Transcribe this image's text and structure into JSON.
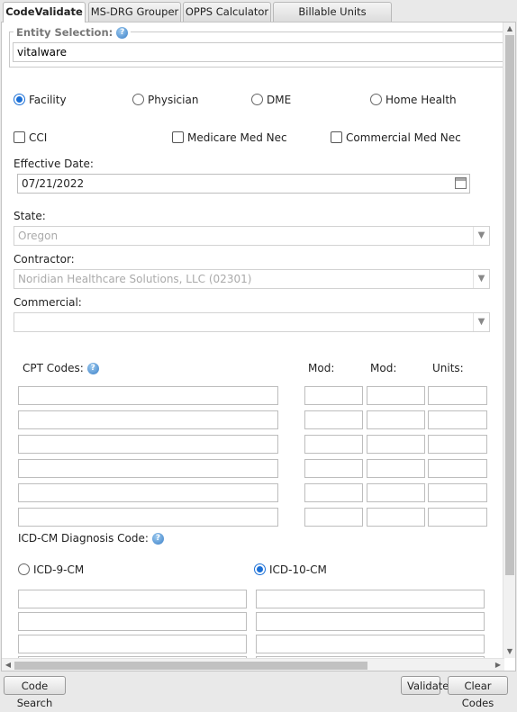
{
  "tabs": [
    {
      "label": "CodeValidate",
      "active": true
    },
    {
      "label": "MS-DRG Grouper",
      "active": false
    },
    {
      "label": "OPPS Calculator",
      "active": false
    },
    {
      "label": "Billable Units Calculator",
      "active": false
    }
  ],
  "entity": {
    "legend": "Entity Selection:",
    "value": "vitalware"
  },
  "provider_types": [
    {
      "label": "Facility",
      "selected": true
    },
    {
      "label": "Physician",
      "selected": false
    },
    {
      "label": "DME",
      "selected": false
    },
    {
      "label": "Home Health",
      "selected": false
    }
  ],
  "checks": [
    {
      "label": "CCI",
      "checked": false
    },
    {
      "label": "Medicare Med Nec",
      "checked": false
    },
    {
      "label": "Commercial Med Nec",
      "checked": false
    }
  ],
  "effective_date": {
    "label": "Effective Date:",
    "value": "07/21/2022"
  },
  "state": {
    "label": "State:",
    "value": "Oregon"
  },
  "contractor": {
    "label": "Contractor:",
    "value": "Noridian Healthcare Solutions, LLC (02301)"
  },
  "commercial": {
    "label": "Commercial:",
    "value": ""
  },
  "cpt": {
    "label": "CPT Codes:",
    "mod1_label": "Mod:",
    "mod2_label": "Mod:",
    "units_label": "Units:",
    "row_count": 6
  },
  "icd": {
    "label": "ICD-CM Diagnosis Code:",
    "icd9_label": "ICD-9-CM",
    "icd10_label": "ICD-10-CM",
    "selected": "ICD-10-CM"
  },
  "footer": {
    "code_search": "Code Search",
    "validate": "Validate",
    "clear_codes": "Clear Codes"
  },
  "colors": {
    "accent": "#1a6fd6",
    "help_icon": "#3a7fc7"
  }
}
